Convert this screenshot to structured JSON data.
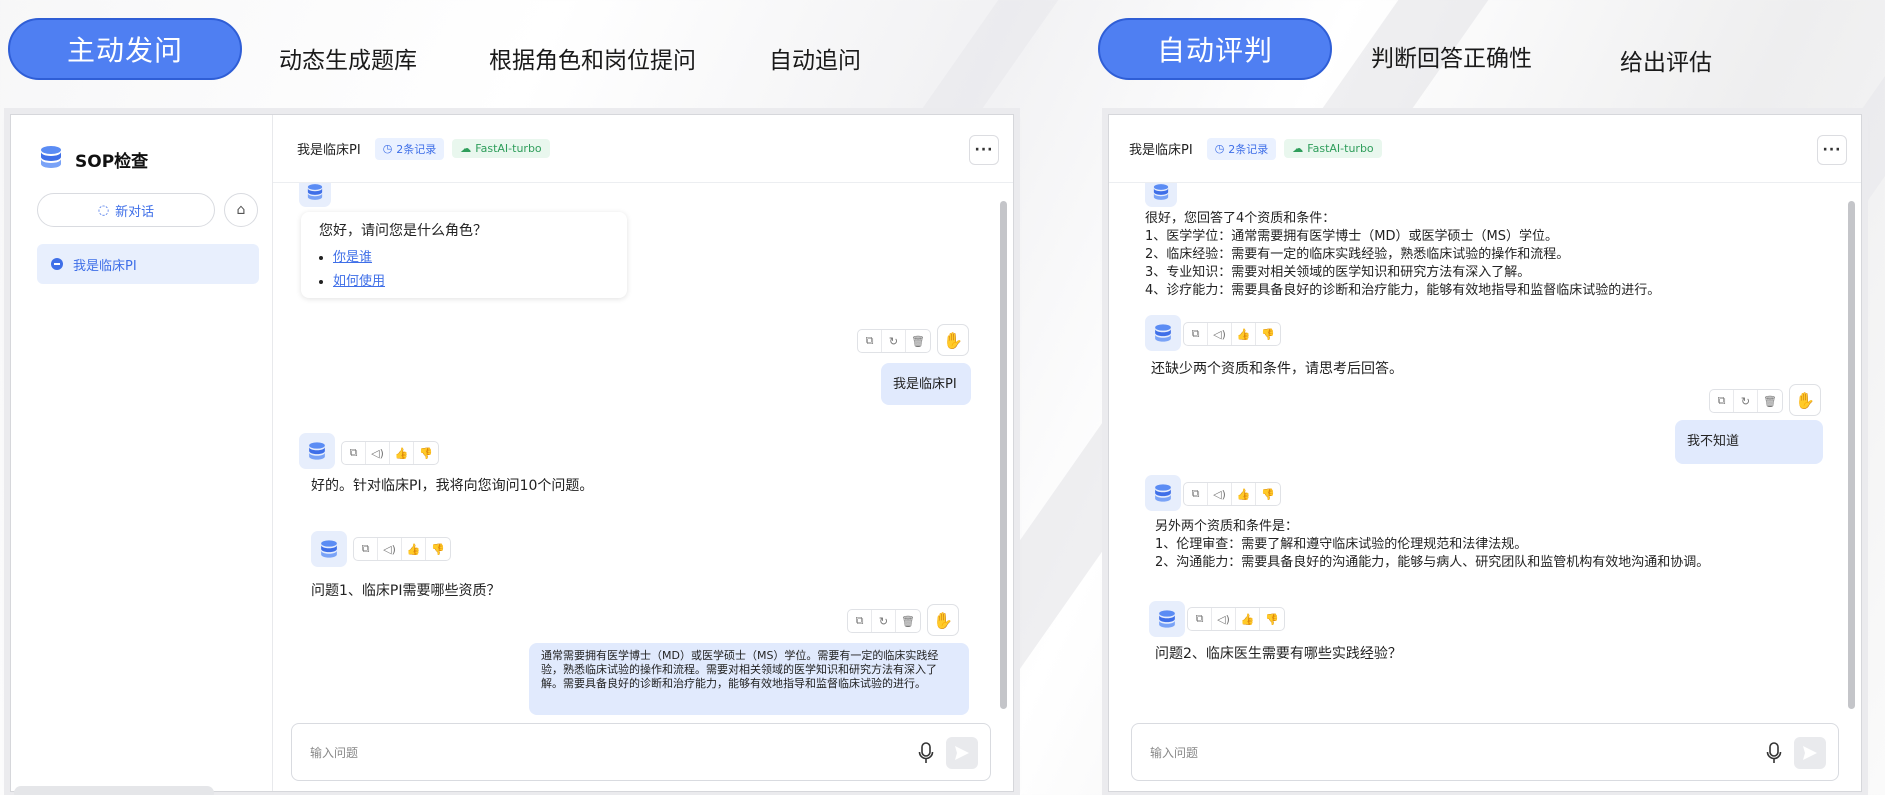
{
  "left_section": {
    "pill_label": "主动发问",
    "labels": [
      "动态生成题库",
      "根据角色和岗位提问",
      "自动追问"
    ]
  },
  "right_section": {
    "pill_label": "自动评判",
    "labels": [
      "判断回答正确性",
      "给出评估"
    ]
  },
  "app": {
    "sidebar_title": "SOP检查",
    "new_chat_label": "新对话",
    "sidebar_items": [
      "我是临床PI"
    ],
    "chat_title": "我是临床PI",
    "records_tag": "2条记录",
    "model_tag": "FastAI-turbo",
    "more_icon": "more-icon",
    "input_placeholder": "输入问题"
  },
  "chat1": {
    "greeting": "您好，请问您是什么角色？",
    "quick_links": [
      "你是谁",
      "如何使用"
    ],
    "user_msg_1": "我是临床PI",
    "bot_msg_1": "好的。针对临床PI，我将向您询问10个问题。",
    "bot_msg_2": "问题1、临床PI需要哪些资质？",
    "user_msg_2": "通常需要拥有医学博士（MD）或医学硕士（MS）学位。需要有一定的临床实践经验，熟悉临床试验的操作和流程。需要对相关领域的医学知识和研究方法有深入了解。需要具备良好的诊断和治疗能力，能够有效地指导和监督临床试验的进行。"
  },
  "chat2": {
    "eval_lines": [
      "很好，您回答了4个资质和条件：",
      "1、医学学位：通常需要拥有医学博士（MD）或医学硕士（MS）学位。",
      "2、临床经验：需要有一定的临床实践经验，熟悉临床试验的操作和流程。",
      "3、专业知识：需要对相关领域的医学知识和研究方法有深入了解。",
      "4、诊疗能力：需要具备良好的诊断和治疗能力，能够有效地指导和监督临床试验的进行。"
    ],
    "missing_msg": "还缺少两个资质和条件，请思考后回答。",
    "user_msg": "我不知道",
    "other_lines": [
      "另外两个资质和条件是：",
      "1、伦理审查：需要了解和遵守临床试验的伦理规范和法律法规。",
      "2、沟通能力：需要具备良好的沟通能力，能够与病人、研究团队和监管机构有效地沟通和协调。"
    ],
    "next_question": "问题2、临床医生需要有哪些实践经验？"
  },
  "colors": {
    "accent": "#4f7ff2",
    "bubble_user": "#e1eafd",
    "tag_green": "#2f9e5b"
  },
  "icons": {
    "bot_avatar": "database-stack-icon",
    "user_avatar": "hand-icon",
    "copy": "copy-icon",
    "retry": "refresh-icon",
    "delete": "trash-icon",
    "speak": "speaker-icon",
    "like": "thumbs-up-icon",
    "dislike": "thumbs-down-icon",
    "mic": "microphone-icon",
    "send": "send-icon",
    "home": "home-icon",
    "clock": "clock-icon",
    "cloud": "cloud-icon"
  }
}
